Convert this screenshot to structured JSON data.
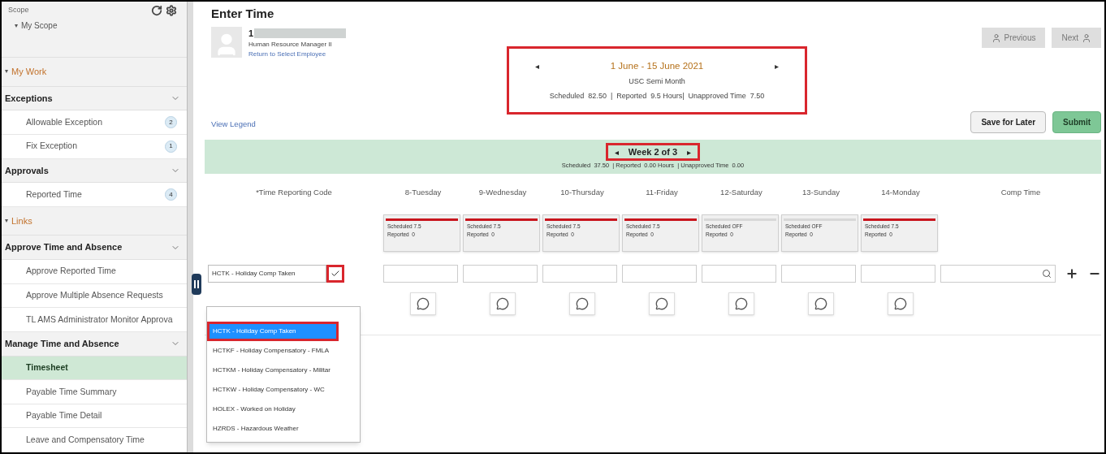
{
  "sidebar": {
    "scope_label": "Scope",
    "scope_item": "My Scope",
    "scope_toggle": "▾",
    "rows": [
      {
        "kind": "section",
        "label": "My Work",
        "toggle": "▾"
      },
      {
        "kind": "header",
        "label": "Exceptions"
      },
      {
        "kind": "item",
        "label": "Allowable Exception",
        "badge": "2",
        "selected": false
      },
      {
        "kind": "item",
        "label": "Fix Exception",
        "badge": "1",
        "selected": false
      },
      {
        "kind": "header",
        "label": "Approvals"
      },
      {
        "kind": "item",
        "label": "Reported Time",
        "badge": "4",
        "selected": false
      },
      {
        "kind": "section",
        "label": "Links",
        "toggle": "▾"
      },
      {
        "kind": "header",
        "label": "Approve Time and Absence"
      },
      {
        "kind": "item",
        "label": "Approve Reported Time",
        "selected": false
      },
      {
        "kind": "item",
        "label": "Approve Multiple Absence Requests",
        "selected": false
      },
      {
        "kind": "item",
        "label": "TL AMS Administrator Monitor Approva",
        "selected": false
      },
      {
        "kind": "header",
        "label": "Manage Time and Absence"
      },
      {
        "kind": "item",
        "label": "Timesheet",
        "selected": true
      },
      {
        "kind": "item",
        "label": "Payable Time Summary",
        "selected": false
      },
      {
        "kind": "item",
        "label": "Payable Time Detail",
        "selected": false
      },
      {
        "kind": "item",
        "label": "Leave and Compensatory Time",
        "selected": false
      }
    ]
  },
  "page": {
    "title": "Enter Time",
    "employee": {
      "name": "1",
      "job": "Human Resource Manager II",
      "link": "Return to Select Employee"
    },
    "nav_buttons": [
      "Previous",
      "Next"
    ],
    "period": {
      "highlighted": true,
      "prev": "◂",
      "range": "1 June - 15 June 2021",
      "next": "▸",
      "type": "USC Semi Month",
      "summary": "Scheduled  82.50  |  Reported  9.5 Hours|  Unapproved Time  7.50"
    },
    "view_legend": "View Legend",
    "actions": [
      {
        "kind": "secondary",
        "label": "Save for Later"
      },
      {
        "kind": "primary",
        "label": "Submit"
      }
    ],
    "week": {
      "highlighted": true,
      "prev": "◂",
      "label": "Week 2 of 3",
      "next": "▸",
      "summary": "Scheduled  37.50  | Reported  0.00 Hours  | Unapproved Time  0.00"
    },
    "columns": [
      "*Time Reporting Code",
      "8-Tuesday",
      "9-Wednesday",
      "10-Thursday",
      "11-Friday",
      "12-Saturday",
      "13-Sunday",
      "14-Monday",
      "Comp Time"
    ],
    "day_cards": [
      {
        "scheduled": "Scheduled 7.5",
        "reported": "Reported  0",
        "flagged": true
      },
      {
        "scheduled": "Scheduled 7.5",
        "reported": "Reported  0",
        "flagged": true
      },
      {
        "scheduled": "Scheduled 7.5",
        "reported": "Reported  0",
        "flagged": true
      },
      {
        "scheduled": "Scheduled 7.5",
        "reported": "Reported  0",
        "flagged": true
      },
      {
        "scheduled": "Scheduled OFF",
        "reported": "Reported  0",
        "flagged": false
      },
      {
        "scheduled": "Scheduled OFF",
        "reported": "Reported  0",
        "flagged": false
      },
      {
        "scheduled": "Scheduled 7.5",
        "reported": "Reported  0",
        "flagged": true
      }
    ],
    "trc_value": "HCTK - Holiday Comp Taken",
    "trc_button_highlighted": true,
    "options": [
      {
        "label": "HCTK - Holiday Comp Taken",
        "selected": true,
        "highlighted": true
      },
      {
        "label": "HCTKF - Holiday Compensatory - FMLA",
        "selected": false,
        "highlighted": false
      },
      {
        "label": "HCTKM - Holiday Compensatory - Militar",
        "selected": false,
        "highlighted": false
      },
      {
        "label": "HCTKW - Holiday Compensatory - WC",
        "selected": false,
        "highlighted": false
      },
      {
        "label": "HOLEX - Worked on Holiday",
        "selected": false,
        "highlighted": false
      },
      {
        "label": "HZRDS - Hazardous Weather",
        "selected": false,
        "highlighted": false
      }
    ]
  }
}
